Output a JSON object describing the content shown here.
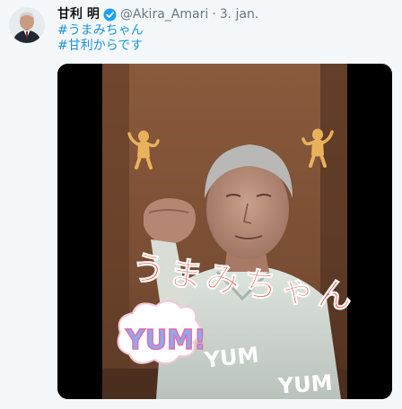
{
  "tweet": {
    "author_name": "甘利 明",
    "handle": "@Akira_Amari",
    "date": "3. jan.",
    "verified": true,
    "hashtags": [
      "#うまみちゃん",
      "#甘利からです"
    ]
  },
  "media": {
    "type": "video",
    "stickers": {
      "caption": "うまみちゃん",
      "yum_big": "YUM!",
      "yum_mid": "YUM",
      "yum_small": "YUM"
    }
  },
  "colors": {
    "name": "#14171a",
    "muted": "#657786",
    "hashtag": "#1b95e0",
    "verified": "#1da1f2",
    "caption": "#f24a3c"
  },
  "icons": {
    "verified": "verified-badge-icon"
  }
}
